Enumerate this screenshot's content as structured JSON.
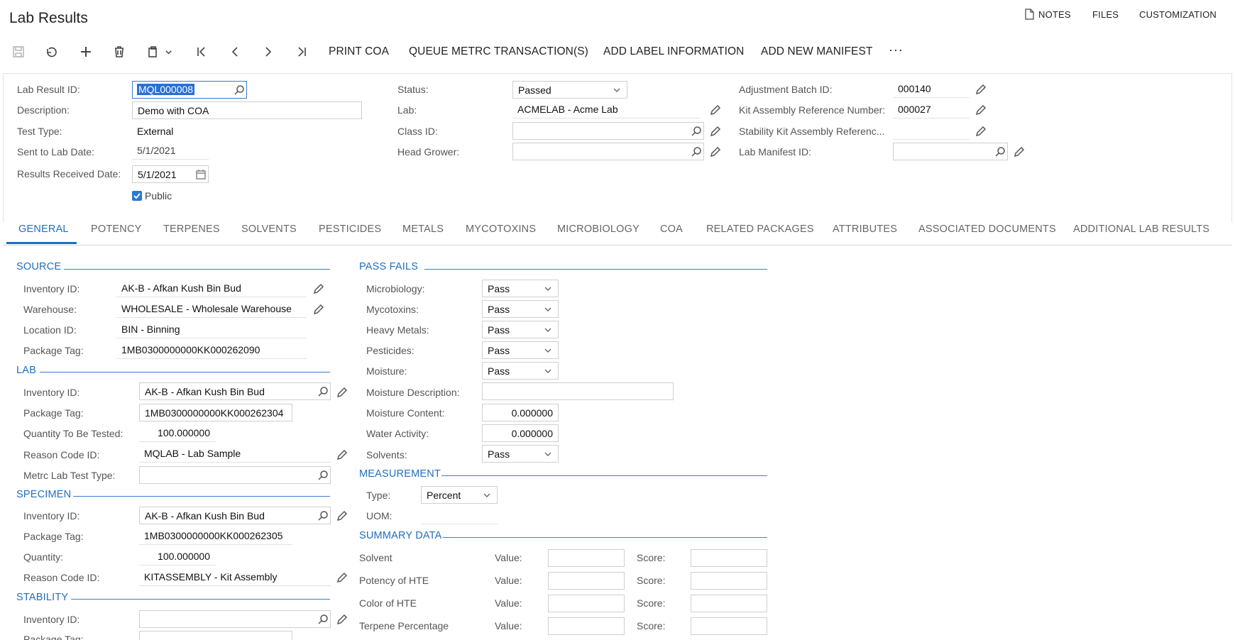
{
  "page": {
    "title": "Lab Results"
  },
  "top_links": {
    "notes": "NOTES",
    "files": "FILES",
    "customization": "CUSTOMIZATION"
  },
  "toolbar": {
    "print_coa": "PRINT COA",
    "queue_metrc": "QUEUE METRC TRANSACTION(S)",
    "add_label": "ADD LABEL INFORMATION",
    "add_manifest": "ADD NEW MANIFEST",
    "more": "···"
  },
  "header": {
    "lab_result_id_label": "Lab Result ID:",
    "lab_result_id": "MQL000008",
    "description_label": "Description:",
    "description": "Demo with COA",
    "test_type_label": "Test Type:",
    "test_type": "External",
    "sent_to_lab_label": "Sent to Lab Date:",
    "sent_to_lab": "5/1/2021",
    "results_received_label": "Results Received Date:",
    "results_received": "5/1/2021",
    "public_label": "Public",
    "status_label": "Status:",
    "status": "Passed",
    "lab_label": "Lab:",
    "lab": "ACMELAB - Acme Lab",
    "class_id_label": "Class ID:",
    "class_id": "",
    "head_grower_label": "Head Grower:",
    "head_grower": "",
    "adjustment_batch_label": "Adjustment Batch ID:",
    "adjustment_batch": "000140",
    "kit_assembly_label": "Kit Assembly Reference Number:",
    "kit_assembly": "000027",
    "stability_kit_label": "Stability Kit Assembly Referenc...",
    "stability_kit": "",
    "lab_manifest_label": "Lab Manifest ID:",
    "lab_manifest": ""
  },
  "tabs": [
    "GENERAL",
    "POTENCY",
    "TERPENES",
    "SOLVENTS",
    "PESTICIDES",
    "METALS",
    "MYCOTOXINS",
    "MICROBIOLOGY",
    "COA",
    "RELATED PACKAGES",
    "ATTRIBUTES",
    "ASSOCIATED DOCUMENTS",
    "ADDITIONAL LAB RESULTS"
  ],
  "source": {
    "title": "SOURCE",
    "inventory_label": "Inventory ID:",
    "inventory": "AK-B - Afkan Kush Bin Bud",
    "warehouse_label": "Warehouse:",
    "warehouse": "WHOLESALE - Wholesale Warehouse",
    "location_label": "Location ID:",
    "location": "BIN - Binning",
    "package_label": "Package Tag:",
    "package": "1MB0300000000KK000262090"
  },
  "lab": {
    "title": "LAB",
    "inventory_label": "Inventory ID:",
    "inventory": "AK-B - Afkan Kush Bin Bud",
    "package_label": "Package Tag:",
    "package": "1MB0300000000KK000262304",
    "quantity_label": "Quantity To Be Tested:",
    "quantity": "100.000000",
    "reason_label": "Reason Code ID:",
    "reason": "MQLAB - Lab Sample",
    "metrc_label": "Metrc Lab Test Type:",
    "metrc": ""
  },
  "specimen": {
    "title": "SPECIMEN",
    "inventory_label": "Inventory ID:",
    "inventory": "AK-B - Afkan Kush Bin Bud",
    "package_label": "Package Tag:",
    "package": "1MB0300000000KK000262305",
    "quantity_label": "Quantity:",
    "quantity": "100.000000",
    "reason_label": "Reason Code ID:",
    "reason": "KITASSEMBLY - Kit Assembly"
  },
  "stability": {
    "title": "STABILITY",
    "inventory_label": "Inventory ID:",
    "inventory": "",
    "package_label": "Package Tag:"
  },
  "pass_fails": {
    "title": "PASS FAILS",
    "microbiology_label": "Microbiology:",
    "microbiology": "Pass",
    "mycotoxins_label": "Mycotoxins:",
    "mycotoxins": "Pass",
    "heavy_metals_label": "Heavy Metals:",
    "heavy_metals": "Pass",
    "pesticides_label": "Pesticides:",
    "pesticides": "Pass",
    "moisture_label": "Moisture:",
    "moisture": "Pass",
    "moisture_desc_label": "Moisture Description:",
    "moisture_desc": "",
    "moisture_content_label": "Moisture Content:",
    "moisture_content": "0.000000",
    "water_activity_label": "Water Activity:",
    "water_activity": "0.000000",
    "solvents_label": "Solvents:",
    "solvents": "Pass"
  },
  "measurement": {
    "title": "MEASUREMENT",
    "type_label": "Type:",
    "type": "Percent",
    "uom_label": "UOM:",
    "uom": ""
  },
  "summary": {
    "title": "SUMMARY DATA",
    "value_label": "Value:",
    "score_label": "Score:",
    "rows": [
      "Solvent",
      "Potency of HTE",
      "Color of HTE",
      "Terpene Percentage"
    ]
  },
  "colors": {
    "accent": "#1f6fbf",
    "focus_border": "#3a7bd5",
    "checkbox": "#2b77d4"
  }
}
